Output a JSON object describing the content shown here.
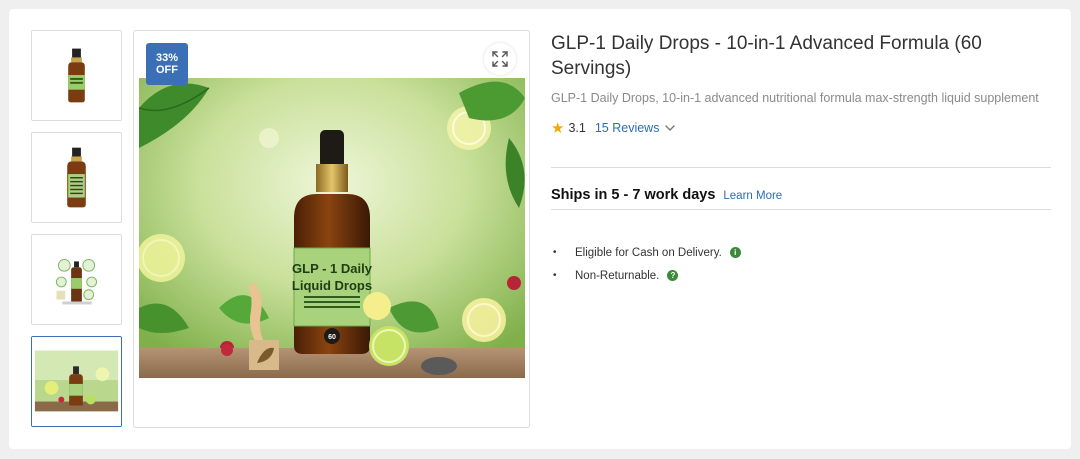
{
  "badge": {
    "percent": "33%",
    "label": "OFF"
  },
  "product": {
    "title": "GLP-1 Daily Drops - 10-in-1 Advanced Formula (60 Servings)",
    "subtitle": "GLP-1 Daily Drops, 10-in-1 advanced nutritional formula max-strength liquid supplement"
  },
  "bottle_label": {
    "line1": "GLP - 1 Daily",
    "line2": "Liquid Drops",
    "count": "60"
  },
  "rating": {
    "score": "3.1",
    "reviews_link": "15 Reviews"
  },
  "shipping": {
    "text": "Ships in 5 - 7 work days",
    "learn_more": "Learn More"
  },
  "features": [
    {
      "text": "Eligible for Cash on Delivery.",
      "icon": "info-icon",
      "glyph": "i"
    },
    {
      "text": "Non-Returnable.",
      "icon": "help-icon",
      "glyph": "?"
    }
  ],
  "thumbnails": [
    {
      "icon": "bottle-front-thumbnail"
    },
    {
      "icon": "bottle-back-thumbnail"
    },
    {
      "icon": "infographic-thumbnail"
    },
    {
      "icon": "lifestyle-thumbnail",
      "selected": true
    }
  ],
  "colors": {
    "accent": "#3b6fb6",
    "link": "#2c6db4",
    "star": "#f2a900",
    "info_icon": "#3a8a3a"
  }
}
